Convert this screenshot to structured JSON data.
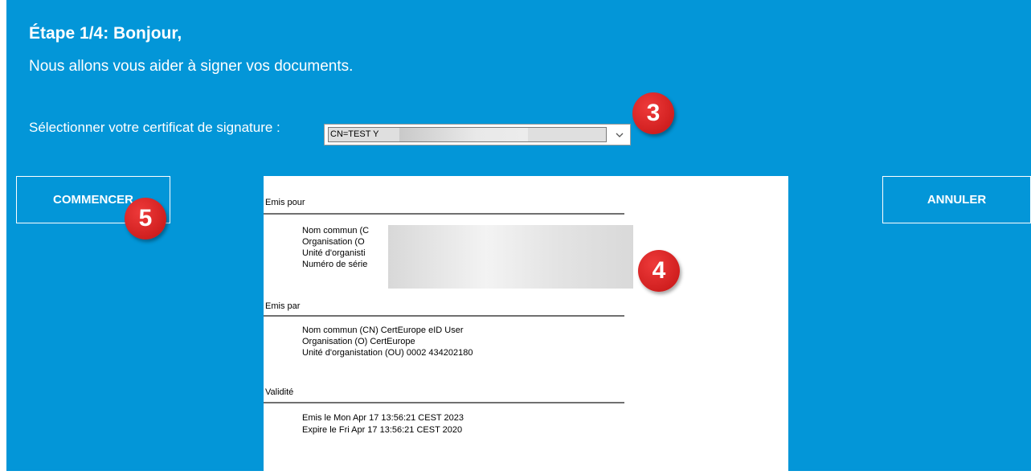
{
  "header": {
    "step_title": "Étape 1/4: Bonjour,",
    "intro": "Nous allons vous aider à signer vos documents."
  },
  "certificate": {
    "label": "Sélectionner votre certificat de signature :",
    "selected_value": "CN=TEST Y"
  },
  "buttons": {
    "start": "COMMENCER",
    "cancel": "ANNULER"
  },
  "details": {
    "issued_for": {
      "title": "Emis pour",
      "lines": [
        "Nom commun (C",
        "Organisation (O",
        "Unité d'organisti",
        "Numéro de série"
      ]
    },
    "issued_by": {
      "title": "Emis par",
      "lines": [
        "Nom commun (CN) CertEurope eID User",
        "Organisation (O) CertEurope",
        "Unité d'organistation (OU) 0002 434202180"
      ]
    },
    "validity": {
      "title": "Validité",
      "lines": [
        "Emis le Mon Apr 17 13:56:21 CEST 2023",
        "Expire le Fri Apr 17 13:56:21 CEST 2020"
      ]
    }
  },
  "annotations": [
    "3",
    "4",
    "5"
  ],
  "colors": {
    "background": "#0396d8",
    "badge": "#d42020",
    "panel": "#ffffff"
  }
}
